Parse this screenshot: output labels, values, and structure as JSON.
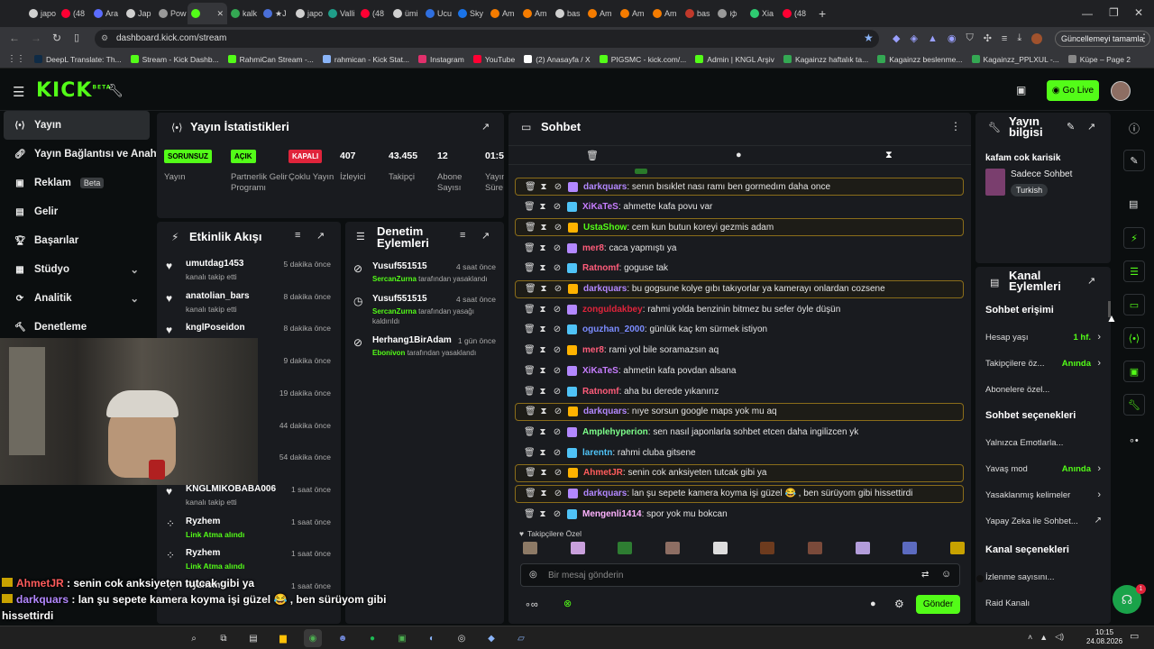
{
  "browser": {
    "tabs": [
      {
        "label": "japo",
        "color": "#d0d0d0"
      },
      {
        "label": "(48",
        "color": "#ff0033"
      },
      {
        "label": "Ara",
        "color": "#5b6cff"
      },
      {
        "label": "Jap",
        "color": "#d0d0d0"
      },
      {
        "label": "Pow",
        "color": "#999"
      },
      {
        "label": "",
        "color": "#53fc18",
        "active": true
      },
      {
        "label": "kalk",
        "color": "#34a853"
      },
      {
        "label": "★J",
        "color": "#4a6fd8"
      },
      {
        "label": "japo",
        "color": "#d0d0d0"
      },
      {
        "label": "Valli",
        "color": "#1f9e89"
      },
      {
        "label": "(48",
        "color": "#ff0033"
      },
      {
        "label": "ümi",
        "color": "#d0d0d0"
      },
      {
        "label": "Ucu",
        "color": "#2f6fdf"
      },
      {
        "label": "Sky",
        "color": "#1a73e8"
      },
      {
        "label": "Am",
        "color": "#f57c00"
      },
      {
        "label": "Am",
        "color": "#f57c00"
      },
      {
        "label": "bas",
        "color": "#d0d0d0"
      },
      {
        "label": "Am",
        "color": "#f57c00"
      },
      {
        "label": "Am",
        "color": "#f57c00"
      },
      {
        "label": "Am",
        "color": "#f57c00"
      },
      {
        "label": "bas",
        "color": "#c0392b"
      },
      {
        "label": "ゆ",
        "color": "#999"
      },
      {
        "label": "Xia",
        "color": "#2ecc71"
      },
      {
        "label": "(48",
        "color": "#ff0033"
      }
    ],
    "url": "dashboard.kick.com/stream",
    "update_label": "Güncellemeyi tamamla",
    "bookmarks": [
      {
        "label": "DeepL Translate: Th...",
        "color": "#0f2b46"
      },
      {
        "label": "Stream - Kick Dashb...",
        "color": "#53fc18"
      },
      {
        "label": "RahmiCan Stream -...",
        "color": "#53fc18"
      },
      {
        "label": "rahmican - Kick Stat...",
        "color": "#8ab4f8"
      },
      {
        "label": "Instagram",
        "color": "#e1306c"
      },
      {
        "label": "YouTube",
        "color": "#ff0033"
      },
      {
        "label": "(2) Anasayfa / X",
        "color": "#ffffff"
      },
      {
        "label": "PIGSMC - kick.com/...",
        "color": "#53fc18"
      },
      {
        "label": "Admin | KNGL Arşiv",
        "color": "#53fc18"
      },
      {
        "label": "Kagainzz haftalık ta...",
        "color": "#34a853"
      },
      {
        "label": "Kagainzz beslenme...",
        "color": "#34a853"
      },
      {
        "label": "Kagainzz_PPLXUL -...",
        "color": "#34a853"
      },
      {
        "label": "Küpe – Page 2",
        "color": "#888"
      }
    ]
  },
  "header": {
    "logo": "KICK",
    "beta": "BETA",
    "golive": "Go Live"
  },
  "sidebar": [
    {
      "label": "Yayın",
      "icon": "broadcast-icon"
    },
    {
      "label": "Yayın Bağlantısı ve Anahtarı",
      "icon": "link-icon"
    },
    {
      "label": "Reklam",
      "icon": "ad-icon",
      "badge": "Beta"
    },
    {
      "label": "Gelir",
      "icon": "wallet-icon"
    },
    {
      "label": "Başarılar",
      "icon": "trophy-icon"
    },
    {
      "label": "Stüdyo",
      "icon": "studio-icon",
      "chevron": true
    },
    {
      "label": "Analitik",
      "icon": "analytics-icon",
      "chevron": true
    },
    {
      "label": "Denetleme",
      "icon": "moderation-icon"
    }
  ],
  "stats": {
    "title": "Yayın İstatistikleri",
    "items": [
      {
        "value": "SORUNSUZ",
        "label": "Yayın",
        "type": "pill",
        "color": "#53fc18"
      },
      {
        "value": "AÇIK",
        "label": "Partnerlik Gelir Programı",
        "type": "pill",
        "color": "#53fc18"
      },
      {
        "value": "KAPALI",
        "label": "Çoklu Yayın",
        "type": "pill",
        "color": "#e0243b"
      },
      {
        "value": "407",
        "label": "İzleyici"
      },
      {
        "value": "43.455",
        "label": "Takipçi"
      },
      {
        "value": "12",
        "label": "Abone Sayısı"
      },
      {
        "value": "01:5",
        "label": "Yayın Oldu Süre"
      }
    ]
  },
  "activity": {
    "title": "Etkinlik Akışı",
    "items": [
      {
        "name": "umutdag1453",
        "sub": "kanalı takip etti",
        "time": "5 dakika önce",
        "icon": "heart-icon"
      },
      {
        "name": "anatolian_bars",
        "sub": "kanalı takip etti",
        "time": "8 dakika önce",
        "icon": "heart-icon"
      },
      {
        "name": "knglPoseidon",
        "sub": "",
        "time": "8 dakika önce",
        "icon": "heart-icon"
      },
      {
        "name": "",
        "sub": "",
        "time": "9 dakika önce",
        "icon": "heart-icon"
      },
      {
        "name": "",
        "sub": "",
        "time": "19 dakika önce",
        "icon": "heart-icon"
      },
      {
        "name": "",
        "sub": "",
        "time": "44 dakika önce",
        "icon": "heart-icon"
      },
      {
        "name": "",
        "sub": "",
        "time": "54 dakika önce",
        "icon": "heart-icon"
      },
      {
        "name": "KNGLMIKOBABA006",
        "sub": "kanalı takip etti",
        "time": "1 saat önce",
        "icon": "heart-icon"
      },
      {
        "name": "Ryzhem",
        "sub": "Link Atma alındı",
        "time": "1 saat önce",
        "icon": "points-icon"
      },
      {
        "name": "Ryzhem",
        "sub": "Link Atma alındı",
        "time": "1 saat önce",
        "icon": "points-icon"
      },
      {
        "name": "Ryzhem",
        "sub": "",
        "time": "1 saat önce",
        "icon": "points-icon"
      }
    ]
  },
  "modlog": {
    "title": "Denetim Eylemleri",
    "items": [
      {
        "name": "Yusuf551515",
        "by": "SercanZurna",
        "action": "tarafından yasaklandı",
        "time": "4 saat önce",
        "icon": "ban-icon"
      },
      {
        "name": "Yusuf551515",
        "by": "SercanZurna",
        "action": "tarafından yasağı kaldırıldı",
        "time": "4 saat önce",
        "icon": "clock-icon"
      },
      {
        "name": "Herhang1BirAdam",
        "by": "Ebonivon",
        "action": "tarafından yasaklandı",
        "time": "1 gün önce",
        "icon": "ban-icon"
      }
    ]
  },
  "chat": {
    "title": "Sohbet",
    "messages": [
      {
        "user": "darkquars",
        "color": "#b388ff",
        "text": "senın bısıklet nası ramı ben gormedım daha once",
        "hl": true
      },
      {
        "user": "XiKaTeS",
        "color": "#c77dff",
        "text": "ahmette kafa povu var"
      },
      {
        "user": "UstaShow",
        "color": "#53fc18",
        "text": "cem kun butun koreyi gezmis adam",
        "hl": true
      },
      {
        "user": "mer8",
        "color": "#ff5c7a",
        "text": "caca yapmıştı ya"
      },
      {
        "user": "Ratnomf",
        "color": "#ff5c7a",
        "text": "goguse tak"
      },
      {
        "user": "darkquars",
        "color": "#b388ff",
        "text": "bu gogsune kolye gıbı takıyorlar ya kamerayı onlardan cozsene",
        "hl": true
      },
      {
        "user": "zonguldakbey",
        "color": "#e0243b",
        "text": "rahmi yolda benzinin bitmez bu sefer öyle düşün"
      },
      {
        "user": "oguzhan_2000",
        "color": "#7b8cff",
        "text": "günlük kaç km sürmek istiyon"
      },
      {
        "user": "mer8",
        "color": "#ff5c7a",
        "text": "rami yol bile soramazsın aq"
      },
      {
        "user": "XiKaTeS",
        "color": "#c77dff",
        "text": "ahmetin kafa povdan alsana"
      },
      {
        "user": "Ratnomf",
        "color": "#ff5c7a",
        "text": "aha bu derede yıkanırız"
      },
      {
        "user": "darkquars",
        "color": "#b388ff",
        "text": "nıye sorsun google maps yok mu aq",
        "hl": true
      },
      {
        "user": "Amplehyperion",
        "color": "#7dff8a",
        "text": "sen nasıl japonlarla sohbet etcen daha ingilizcen yk"
      },
      {
        "user": "larentn",
        "color": "#4fc3f7",
        "text": "rahmi cluba gitsene"
      },
      {
        "user": "AhmetJR",
        "color": "#ff5c5c",
        "text": "senin cok anksiyeten tutcak gibi ya",
        "hl": true
      },
      {
        "user": "darkquars",
        "color": "#b388ff",
        "text": "lan şu sepete kamera koyma işi güzel 😂 , ben sürüyom gibi hissettirdi",
        "hl": true
      },
      {
        "user": "Mengenli1414",
        "color": "#ffb3ff",
        "text": "spor yok mu bokcan"
      }
    ],
    "followers_label": "Takipçilere Özel",
    "placeholder": "Bir mesaj gönderin",
    "send": "Gönder"
  },
  "streaminfo": {
    "title": "Yayın bilgisi",
    "stream_title": "kafam cok karisik",
    "category": "Sadece Sohbet",
    "language": "Turkish"
  },
  "channel": {
    "title": "Kanal Eylemleri",
    "chat_access": "Sohbet erişimi",
    "rows1": [
      {
        "label": "Hesap yaşı",
        "value": "1 hf.",
        "kind": "chev"
      },
      {
        "label": "Takipçilere öz...",
        "value": "Anında",
        "kind": "chev"
      },
      {
        "label": "Abonelere özel...",
        "value": "",
        "kind": "toggle",
        "on": false
      }
    ],
    "chat_opts": "Sohbet seçenekleri",
    "rows2": [
      {
        "label": "Yalnızca Emotlarla...",
        "value": "",
        "kind": "toggle",
        "on": false
      },
      {
        "label": "Yavaş mod",
        "value": "Anında",
        "kind": "chev"
      },
      {
        "label": "Yasaklanmış kelimeler",
        "value": "",
        "kind": "chev"
      },
      {
        "label": "Yapay Zeka ile Sohbet...",
        "value": "",
        "kind": "ext"
      }
    ],
    "channel_opts": "Kanal seçenekleri",
    "rows3": [
      {
        "label": "İzlenme sayısını...",
        "value": "",
        "kind": "toggle",
        "on": true
      },
      {
        "label": "Raid Kanalı",
        "value": "",
        "kind": "none"
      }
    ]
  },
  "overlay": {
    "lines": [
      {
        "user": "AhmetJR",
        "color": "#ff5c5c",
        "text": " : senin cok anksiyeten tutcak gibi ya"
      },
      {
        "user": "darkquars",
        "color": "#b388ff",
        "text": " : lan şu sepete kamera koyma işi güzel 😂 , ben sürüyom gibi hissettirdi"
      },
      {
        "user": "Mengenli1414",
        "color": "#ffb3ff",
        "text": " : spor yok mu bokcan"
      }
    ]
  },
  "taskbar": {
    "time": "10:15",
    "date": "24.08.2026"
  },
  "misc": {
    "notif_count": "1"
  }
}
